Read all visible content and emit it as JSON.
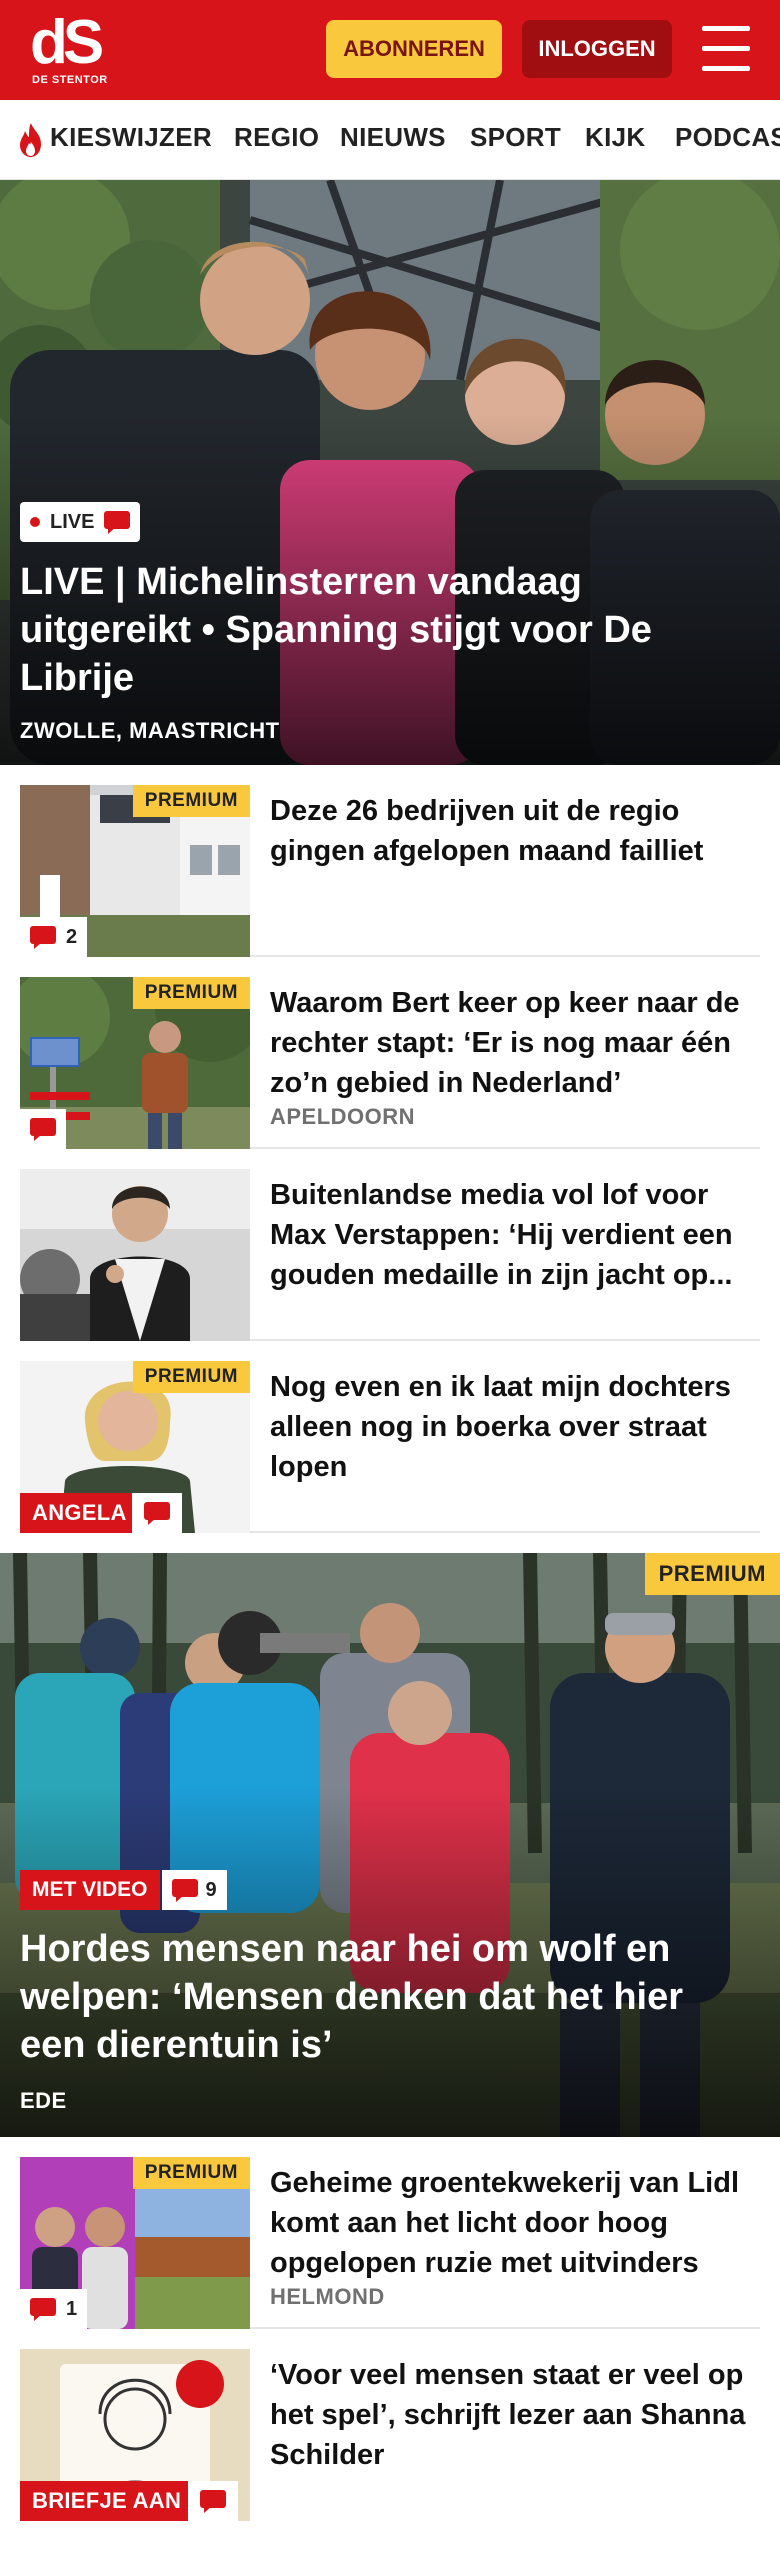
{
  "header": {
    "logo_mark": "dS",
    "logo_sub": "DE STENTOR",
    "subscribe_label": "ABONNEREN",
    "login_label": "INLOGGEN"
  },
  "nav": {
    "items": [
      "KIESWIJZER",
      "REGIO",
      "NIEUWS",
      "SPORT",
      "KIJK",
      "PODCAS"
    ]
  },
  "hero": {
    "live_label": "LIVE",
    "title": "LIVE | Michelinsterren vandaag uitgereikt • Spanning stijgt voor De Librije",
    "location": "ZWOLLE, MAASTRICHT"
  },
  "articles": [
    {
      "premium": "PREMIUM",
      "comments": "2",
      "title": "Deze 26 bedrijven uit de regio gingen afgelopen maand failliet",
      "location": ""
    },
    {
      "premium": "PREMIUM",
      "comments": "",
      "title": "Waarom Bert keer op keer naar de rechter stapt: ‘Er is nog maar één zo’n gebied in Nederland’",
      "location": "APELDOORN"
    },
    {
      "premium": "",
      "comments": "",
      "title": "Buitenlandse media vol lof voor Max Verstappen: ‘Hij verdient een gouden medaille in zijn jacht op...",
      "location": ""
    },
    {
      "premium": "PREMIUM",
      "label": "ANGELA",
      "title": "Nog even en ik laat mijn dochters alleen nog in boerka over straat lopen",
      "location": ""
    }
  ],
  "feature": {
    "premium": "PREMIUM",
    "video_label": "MET VIDEO",
    "comments": "9",
    "title": "Hordes mensen naar hei om wolf en welpen: ‘Mensen denken dat het hier een dierentuin is’",
    "location": "EDE"
  },
  "articles2": [
    {
      "premium": "PREMIUM",
      "comments": "1",
      "title": "Geheime groentekwekerij van Lidl komt aan het licht door hoog opgelopen ruzie met uitvinders",
      "location": "HELMOND"
    },
    {
      "label": "BRIEFJE AAN",
      "title": "‘Voor veel mensen staat er veel op het spel’, schrijft lezer aan Shanna Schilder",
      "location": ""
    }
  ],
  "colors": {
    "brand_red": "#d7141a",
    "premium_yellow": "#f9c83d",
    "login_dark_red": "#a10e12"
  }
}
